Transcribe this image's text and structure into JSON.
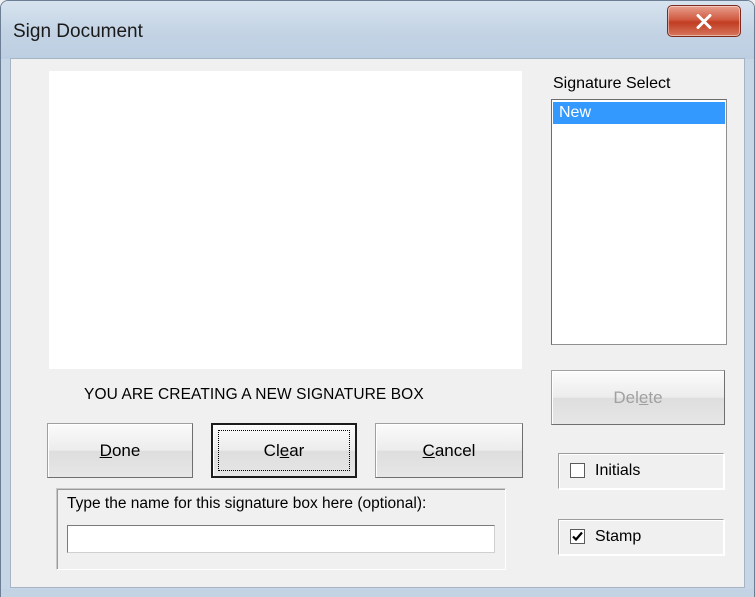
{
  "window": {
    "title": "Sign Document",
    "close_icon": "close-icon"
  },
  "signature_select": {
    "label": "Signature Select",
    "items": [
      "New"
    ],
    "selected_index": 0
  },
  "canvas": {
    "message": "YOU ARE CREATING A NEW SIGNATURE BOX"
  },
  "buttons": {
    "done": {
      "pre": "",
      "mnemonic": "D",
      "post": "one"
    },
    "clear": {
      "pre": "Cl",
      "mnemonic": "e",
      "post": "ar"
    },
    "cancel": {
      "pre": "",
      "mnemonic": "C",
      "post": "ancel"
    },
    "delete": {
      "pre": "Del",
      "mnemonic": "e",
      "post": "te"
    }
  },
  "name_field": {
    "label": "Type the name for this signature box here (optional):",
    "value": ""
  },
  "options": {
    "initials": {
      "label": "Initials",
      "checked": false
    },
    "stamp": {
      "label": "Stamp",
      "checked": true
    }
  },
  "colors": {
    "selection": "#3399ff",
    "close_button": "#c13d22"
  }
}
